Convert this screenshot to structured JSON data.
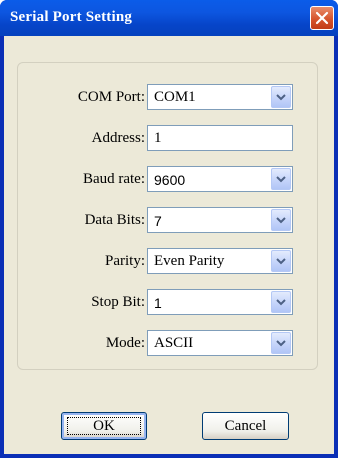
{
  "window": {
    "title": "Serial Port Setting"
  },
  "form": {
    "com_port": {
      "label": "COM Port:",
      "value": "COM1"
    },
    "address": {
      "label": "Address:",
      "value": "1"
    },
    "baud_rate": {
      "label": "Baud rate:",
      "value": "9600"
    },
    "data_bits": {
      "label": "Data Bits:",
      "value": "7"
    },
    "parity": {
      "label": "Parity:",
      "value": "Even Parity"
    },
    "stop_bit": {
      "label": "Stop Bit:",
      "value": "1"
    },
    "mode": {
      "label": "Mode:",
      "value": "ASCII"
    }
  },
  "buttons": {
    "ok": "OK",
    "cancel": "Cancel"
  },
  "colors": {
    "titlebar": "#0a58e6",
    "dialog_bg": "#ece9d8",
    "close": "#d6542d",
    "field_border": "#7f9db9"
  }
}
